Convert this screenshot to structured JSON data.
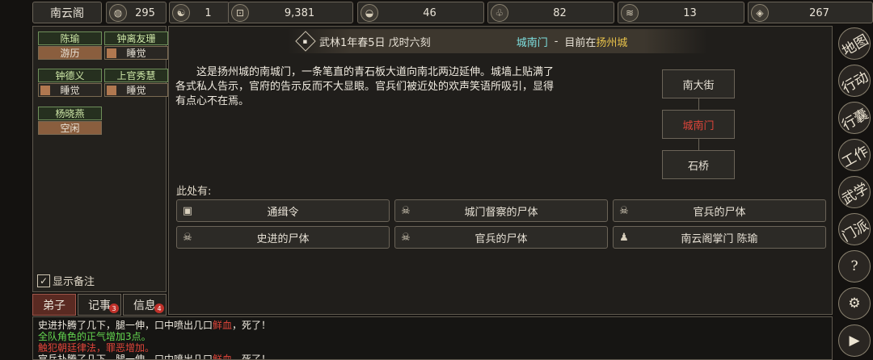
{
  "topbar": {
    "sect_name": "南云阁",
    "stats": [
      {
        "icon": "coin-bag-icon",
        "glyph": "◍",
        "value": "295"
      },
      {
        "icon": "yin-yang-icon",
        "glyph": "☯",
        "value": "1"
      },
      {
        "icon": "copper-coin-icon",
        "glyph": "⊡",
        "value": "9,381"
      },
      {
        "icon": "food-bowl-icon",
        "glyph": "◒",
        "value": "46"
      },
      {
        "icon": "herb-icon",
        "glyph": "♧",
        "value": "82"
      },
      {
        "icon": "scroll-icon",
        "glyph": "≋",
        "value": "13"
      },
      {
        "icon": "ore-icon",
        "glyph": "◈",
        "value": "267"
      }
    ]
  },
  "disciples": [
    {
      "name": "陈瑜",
      "status": "游历",
      "active": true
    },
    {
      "name": "钟离友珊",
      "status": "睡觉",
      "active": false
    },
    {
      "name": "钟德义",
      "status": "睡觉",
      "active": false
    },
    {
      "name": "上官秀慧",
      "status": "睡觉",
      "active": false
    },
    {
      "name": "杨晓燕",
      "status": "空闲",
      "active": true
    }
  ],
  "memo_label": "显示备注",
  "tabs": [
    {
      "label": "弟子",
      "badge": ""
    },
    {
      "label": "记事",
      "badge": "3"
    },
    {
      "label": "信息",
      "badge": "4"
    }
  ],
  "header": {
    "datetime": "武林1年春5日 戊时六刻",
    "location": "城南门",
    "separator": "-",
    "now_at": "目前在",
    "city": "扬州城"
  },
  "description": "这是扬州城的南城门，一条笔直的青石板大道向南北两边延伸。城墙上贴满了各式私人告示，官府的告示反而不大显眼。官兵们被近处的欢声笑语所吸引，显得有点心不在焉。",
  "map": {
    "north": "南大街",
    "current": "城南门",
    "south": "石桥"
  },
  "here_label": "此处有:",
  "objects": [
    {
      "icon": "box-icon",
      "glyph": "▣",
      "label": "通缉令"
    },
    {
      "icon": "skull-icon",
      "glyph": "☠",
      "label": "城门督察的尸体"
    },
    {
      "icon": "skull-icon",
      "glyph": "☠",
      "label": "官兵的尸体"
    },
    {
      "icon": "skull-icon",
      "glyph": "☠",
      "label": "史进的尸体"
    },
    {
      "icon": "skull-icon",
      "glyph": "☠",
      "label": "官兵的尸体"
    },
    {
      "icon": "person-icon",
      "glyph": "♟",
      "label": "南云阁掌门 陈瑜"
    }
  ],
  "right_menu": [
    {
      "label": "地图"
    },
    {
      "label": "行动"
    },
    {
      "label": "行囊"
    },
    {
      "label": "工作"
    },
    {
      "label": "武学"
    },
    {
      "label": "门派"
    },
    {
      "label": "?"
    },
    {
      "label": "⚙"
    },
    {
      "label": "▶"
    }
  ],
  "log": {
    "line1_a": "史进扑腾了几下，腿一伸，口中喷出几口",
    "line1_b": "鲜血",
    "line1_c": "，死了！",
    "line2": "全队角色的正气增加3点。",
    "line3": "触犯朝廷律法，罪恶增加。",
    "line4_a": "官兵扑腾了几下，腿一伸，口中喷出几口",
    "line4_b": "鲜血",
    "line4_c": "，死了！"
  }
}
